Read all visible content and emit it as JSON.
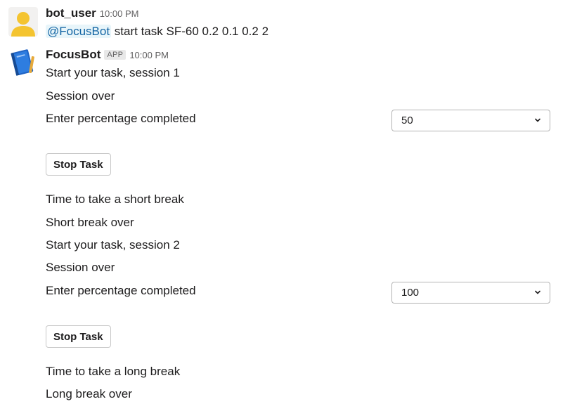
{
  "messages": {
    "user": {
      "name": "bot_user",
      "time": "10:00 PM",
      "mention": "@FocusBot",
      "text": " start task SF-60 0.2 0.1 0.2 2"
    },
    "bot": {
      "name": "FocusBot",
      "badge": "APP",
      "time": "10:00 PM",
      "lines": [
        "Start your task, session 1",
        "Session over",
        "Enter percentage completed",
        "Time to take a short break",
        "Short break over",
        "Start your task, session 2",
        "Session over",
        "Enter percentage completed",
        "Time to take a long break",
        "Long break over"
      ],
      "selects": [
        {
          "value": "50"
        },
        {
          "value": "100"
        }
      ],
      "buttons": [
        {
          "label": "Stop Task"
        },
        {
          "label": "Stop Task"
        }
      ]
    }
  },
  "colors": {
    "mention": "#1264a3",
    "mention_bg": "#e8f5fa",
    "avatar_user": "#f4c430"
  },
  "icons": {
    "user_avatar": "person-avatar-icon",
    "bot_avatar": "book-avatar-icon",
    "select_caret": "chevron-down-icon"
  }
}
